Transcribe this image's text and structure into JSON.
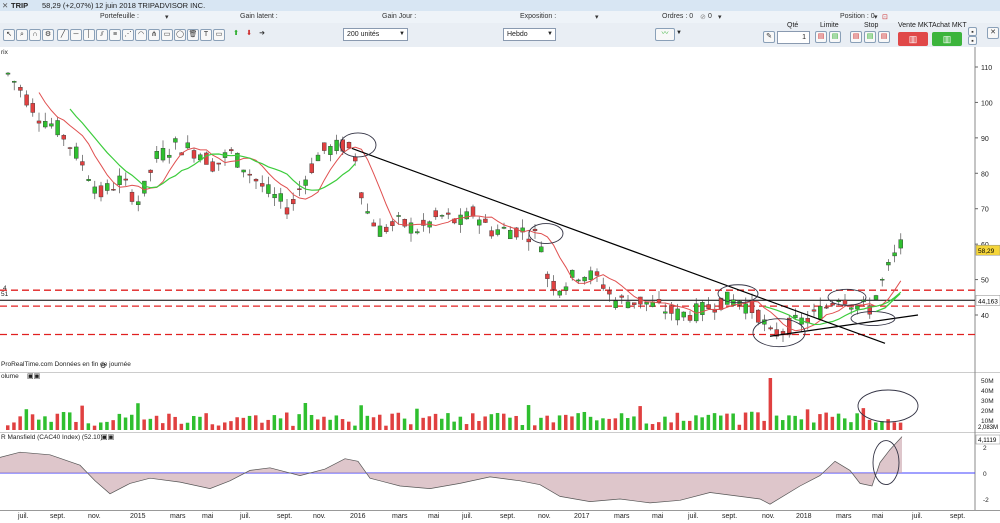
{
  "titlebar": {
    "symbol": "TRIP",
    "price_change": "58,29 (+2,07%)",
    "date_company": "12 juin 2018 TRIPADVISOR INC."
  },
  "header": {
    "portefeuille": "Portefeuille :",
    "gain_latent": "Gain latent :",
    "gain_jour": "Gain Jour :",
    "exposition": "Exposition :",
    "ordres": "Ordres : 0",
    "ordres_b": "0",
    "position": "Position : 0"
  },
  "toolbar": {
    "units_select": "200 unités",
    "period_select": "Hebdo",
    "qty_label": "Qté",
    "qty_value": "1",
    "limite_label": "Limite",
    "stop_label": "Stop",
    "vente_label": "Vente MKT",
    "achat_label": "Achat MKT"
  },
  "chart_panel": {
    "price_tag": "58,29",
    "ref_tag": "44,163",
    "left_label_a": "4",
    "left_label_b": "51",
    "left_label_prix": "rix",
    "source": "ProRealTime.com  Données en fin de journée",
    "y_ticks": [
      "110",
      "100",
      "90",
      "80",
      "70",
      "60",
      "50",
      "40"
    ]
  },
  "volume_panel": {
    "label": "olume",
    "y_ticks": [
      "50M",
      "40M",
      "30M",
      "20M",
      "10M"
    ],
    "last_tag": "2,083M"
  },
  "mansfield_panel": {
    "label": "R Mansfield (CAC40 Index) (52.10)",
    "last_tag": "4,1119",
    "y_ticks": [
      "2",
      "0",
      "-2"
    ]
  },
  "x_axis": [
    "juil.",
    "sept.",
    "nov.",
    "2015",
    "mars",
    "mai",
    "juil.",
    "sept.",
    "nov.",
    "2016",
    "mars",
    "mai",
    "juil.",
    "sept.",
    "nov.",
    "2017",
    "mars",
    "mai",
    "juil.",
    "sept.",
    "nov.",
    "2018",
    "mars",
    "mai",
    "juil.",
    "sept."
  ],
  "colors": {
    "up": "#2fbf2f",
    "down": "#e04040",
    "ma_red": "#e05050",
    "ma_green": "#3ccc3c",
    "trend": "#000000"
  }
}
